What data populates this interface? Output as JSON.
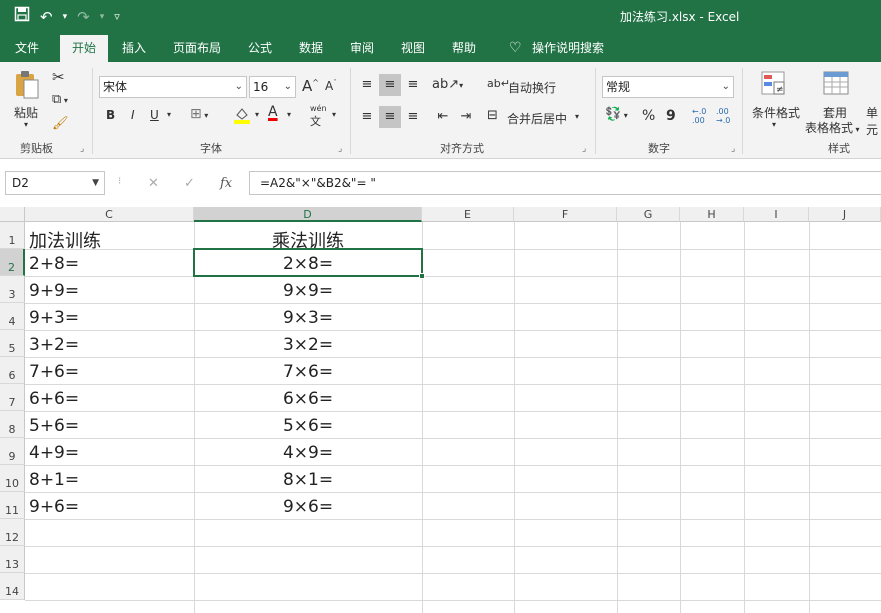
{
  "window": {
    "title": "加法练习.xlsx  -  Excel"
  },
  "qat": {
    "save_icon": "save-icon",
    "undo_icon": "undo-icon",
    "redo_icon": "redo-icon",
    "customize_icon": "customize-icon"
  },
  "tabs": [
    {
      "label": "文件"
    },
    {
      "label": "开始"
    },
    {
      "label": "插入"
    },
    {
      "label": "页面布局"
    },
    {
      "label": "公式"
    },
    {
      "label": "数据"
    },
    {
      "label": "审阅"
    },
    {
      "label": "视图"
    },
    {
      "label": "帮助"
    },
    {
      "label": "操作说明搜索"
    }
  ],
  "ribbon": {
    "clipboard": {
      "paste": "粘贴",
      "group": "剪贴板"
    },
    "font": {
      "name": "宋体",
      "size": "16",
      "group": "字体",
      "bold": "B",
      "italic": "I",
      "underline": "U",
      "grow": "A",
      "shrink": "A",
      "phonetic": "wén"
    },
    "alignment": {
      "wrap": "自动换行",
      "merge": "合并后居中",
      "group": "对齐方式"
    },
    "number": {
      "format": "常规",
      "percent": "%",
      "comma": "9",
      "group": "数字",
      "dec_inc": "←.0\n.00",
      "dec_dec": ".00\n→.0"
    },
    "styles": {
      "cond": "条件格式",
      "table_line1": "套用",
      "table_line2": "表格格式",
      "cell": "单元",
      "group": "样式"
    }
  },
  "formula_bar": {
    "name_box": "D2",
    "formula": "=A2&\"×\"&B2&\"= \""
  },
  "columns": [
    {
      "label": "C"
    },
    {
      "label": "D"
    },
    {
      "label": "E"
    },
    {
      "label": "F"
    },
    {
      "label": "G"
    },
    {
      "label": "H"
    },
    {
      "label": "I"
    },
    {
      "label": "J"
    }
  ],
  "rows": [
    "1",
    "2",
    "3",
    "4",
    "5",
    "6",
    "7",
    "8",
    "9",
    "10",
    "11",
    "12",
    "13",
    "14"
  ],
  "cells": {
    "C": [
      "加法训练",
      "2+8=",
      "9+9=",
      "9+3=",
      "3+2=",
      "7+6=",
      "6+6=",
      "5+6=",
      "4+9=",
      "8+1=",
      "9+6="
    ],
    "D": [
      "乘法训练",
      "2×8=",
      "9×9=",
      "9×3=",
      "3×2=",
      "7×6=",
      "6×6=",
      "5×6=",
      "4×9=",
      "8×1=",
      "9×6="
    ]
  },
  "colors": {
    "accent": "#217346",
    "tab_bg": "#217346"
  }
}
